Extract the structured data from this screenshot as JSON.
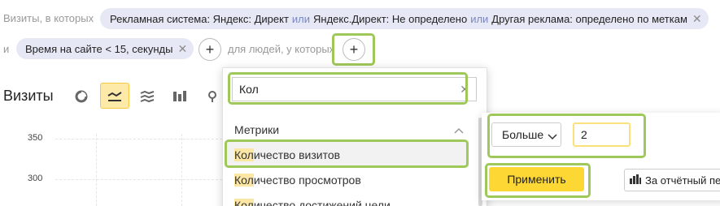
{
  "filters": {
    "row1_prefix": "Визиты, в которых",
    "chip1": {
      "part1": "Рекламная система: Яндекс: Директ",
      "or1": "или",
      "part2": "Яндекс.Директ: Не определено",
      "or2": "или",
      "part3": "Другая реклама: определено по меткам",
      "close": "✕"
    },
    "row2_prefix": "и",
    "chip2": {
      "label": "Время на сайте < 15, секунды",
      "close": "✕"
    },
    "plus": "+",
    "people_text": "для людей, у которых"
  },
  "chart": {
    "title": "Визиты",
    "icons": [
      "pie-chart-icon",
      "line-chart-icon",
      "area-chart-icon",
      "bar-chart-icon",
      "map-pin-icon"
    ],
    "y_ticks": [
      "350",
      "300"
    ]
  },
  "dropdown": {
    "search_value": "Кол",
    "clear": "✕",
    "section": "Метрики",
    "items": [
      {
        "hl": "Кол",
        "rest": "ичество визитов"
      },
      {
        "hl": "Кол",
        "rest": "ичество просмотров"
      },
      {
        "hl": "Кол",
        "rest": "ичество достижений цели"
      }
    ]
  },
  "condition": {
    "operator": "Больше",
    "value": "2",
    "apply": "Применить",
    "period": "За отчётный пе"
  },
  "colors": {
    "accent_green": "#9fc85a",
    "chip_bg": "#e6e9f5",
    "apply_yellow": "#fdd835",
    "highlight": "#fce6a4"
  }
}
